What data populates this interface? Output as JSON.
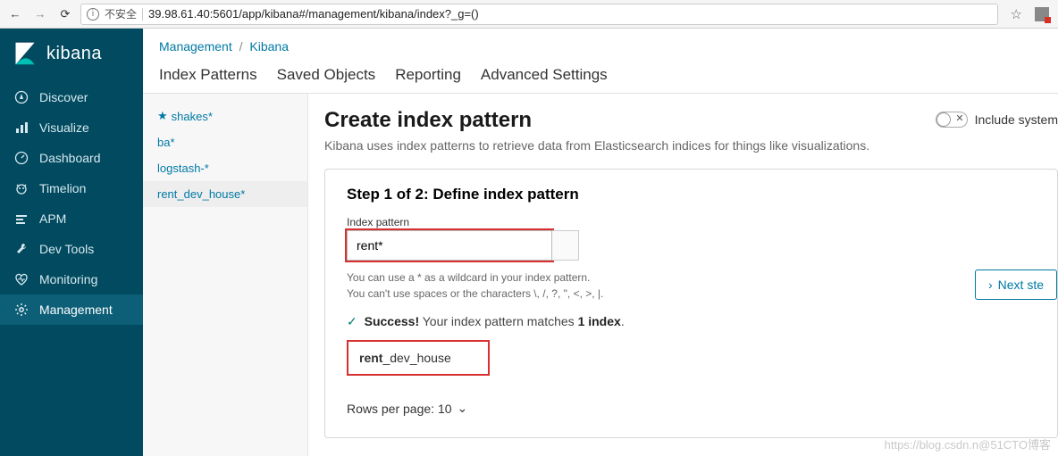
{
  "browser": {
    "insecure_label": "不安全",
    "url": "39.98.61.40:5601/app/kibana#/management/kibana/index?_g=()"
  },
  "brand": {
    "name": "kibana"
  },
  "sidebar": {
    "items": [
      {
        "label": "Discover"
      },
      {
        "label": "Visualize"
      },
      {
        "label": "Dashboard"
      },
      {
        "label": "Timelion"
      },
      {
        "label": "APM"
      },
      {
        "label": "Dev Tools"
      },
      {
        "label": "Monitoring"
      },
      {
        "label": "Management"
      }
    ]
  },
  "breadcrumb": {
    "a": "Management",
    "b": "Kibana"
  },
  "tabs": {
    "items": [
      {
        "label": "Index Patterns"
      },
      {
        "label": "Saved Objects"
      },
      {
        "label": "Reporting"
      },
      {
        "label": "Advanced Settings"
      }
    ]
  },
  "patterns_list": {
    "items": [
      {
        "label": "shakes*",
        "starred": true
      },
      {
        "label": "ba*"
      },
      {
        "label": "logstash-*"
      },
      {
        "label": "rent_dev_house*"
      }
    ]
  },
  "main": {
    "title": "Create index pattern",
    "subtitle": "Kibana uses index patterns to retrieve data from Elasticsearch indices for things like visualizations.",
    "include_system_label": "Include system",
    "step_title": "Step 1 of 2: Define index pattern",
    "field_label": "Index pattern",
    "input_value": "rent*",
    "hint1": "You can use a * as a wildcard in your index pattern.",
    "hint2": "You can't use spaces or the characters \\, /, ?, \", <, >, |.",
    "success_prefix": "Success!",
    "success_text": "  Your index pattern matches ",
    "success_count": "1 index",
    "success_suffix": ".",
    "match_bold": "rent",
    "match_rest": "_dev_house",
    "rows_label": "Rows per page: 10",
    "next_label": "Next ste"
  },
  "watermark": "https://blog.csdn.n@51CTO博客"
}
